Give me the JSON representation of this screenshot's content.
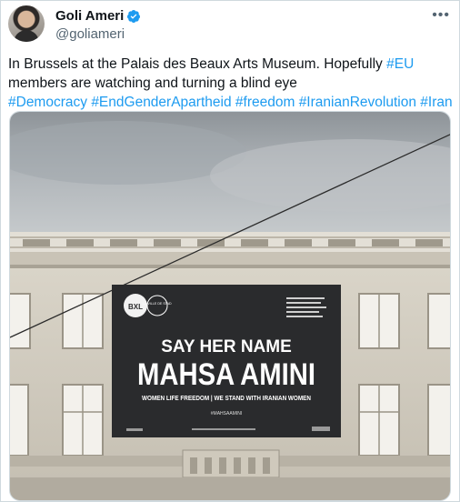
{
  "author": {
    "display_name": "Goli Ameri",
    "handle": "@goliameri"
  },
  "tweet": {
    "text_plain": "In Brussels at the Palais des Beaux Arts Museum. Hopefully ",
    "mention_tag": "#EU",
    "text_after": " members are watching and turning a blind eye",
    "hashtags": [
      "#Democracy",
      "#EndGenderApartheid",
      "#freedom",
      "#IranianRevolution",
      "#Iran"
    ]
  },
  "banner": {
    "logo_text": "BXL",
    "logo_sub": "LA VILLE DE STAD",
    "headline_small": "SAY HER NAME",
    "headline_large": "MAHSA AMINI",
    "slogan": "WOMEN LIFE FREEDOM | WE STAND WITH IRANIAN WOMEN",
    "hashtag": "#MAHSAAMINI"
  },
  "colors": {
    "accent": "#1d9bf0",
    "text": "#0f1419",
    "secondary": "#536471"
  },
  "icons": {
    "verified": "verified-badge-icon",
    "more": "more-options-icon"
  }
}
